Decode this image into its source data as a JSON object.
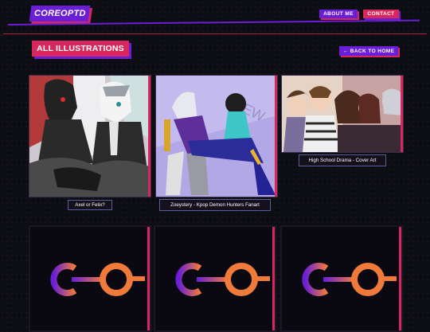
{
  "header": {
    "logo": "COREOPTD",
    "nav": {
      "about": "ABOUT ME",
      "contact": "CONTACT"
    }
  },
  "page": {
    "title": "ALL ILLUSTRATIONS",
    "back": "← BACK TO HOME"
  },
  "gallery": [
    {
      "caption": "Axel or Felix?"
    },
    {
      "caption": "Zoeystery - Kpop Demon Hunters Fanart"
    },
    {
      "caption": "High School Drama - Cover Art"
    }
  ],
  "colors": {
    "purple": "#6a1fd6",
    "red": "#d8275c",
    "background": "#0d0d14"
  }
}
